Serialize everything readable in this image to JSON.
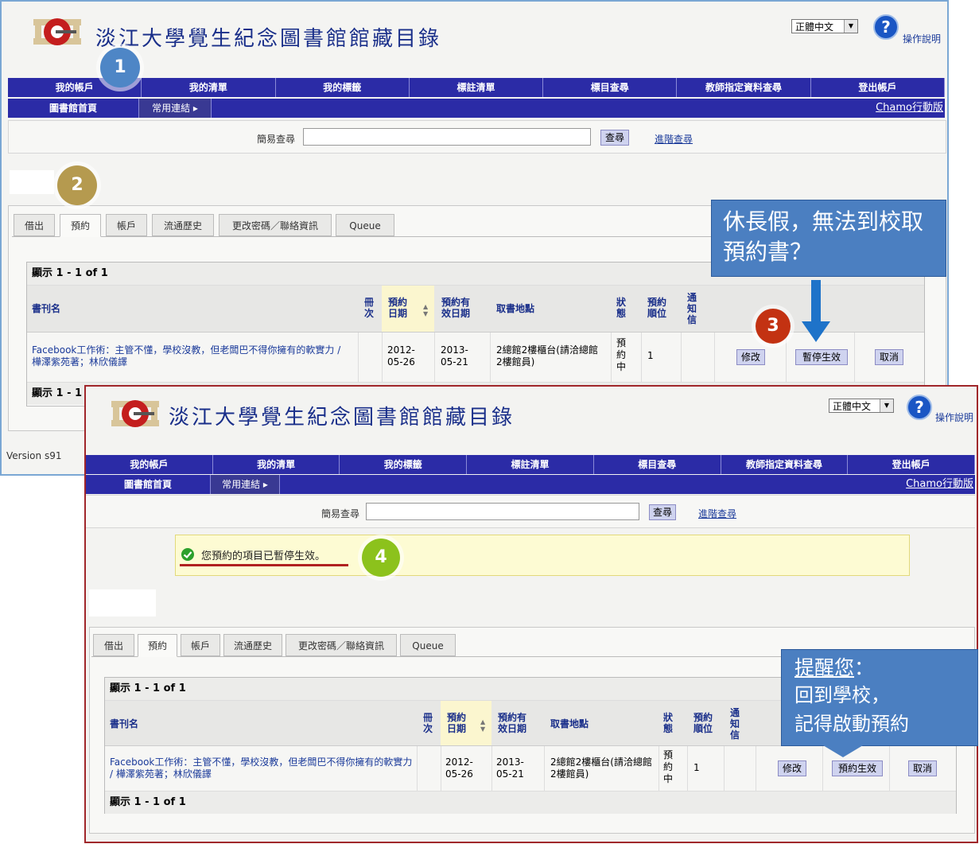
{
  "site": {
    "title": "淡江大學覺生紀念圖書館館藏目錄",
    "language_select": "正體中文",
    "help_label": "操作說明"
  },
  "nav": {
    "top": [
      "我的帳戶",
      "我的清單",
      "我的標籤",
      "標註清單",
      "標目查尋",
      "教師指定資料查尋",
      "登出帳戶"
    ],
    "library_home": "圖書館首頁",
    "common_links": "常用連結",
    "mobile": "Chamo行動版"
  },
  "search": {
    "label": "簡易查尋",
    "button": "查尋",
    "advanced": "進階查尋"
  },
  "tabs": [
    "借出",
    "預約",
    "帳戶",
    "流通歷史",
    "更改密碼／聯絡資訊",
    "Queue"
  ],
  "table": {
    "summary": "顯示 1 - 1 of 1",
    "headers": {
      "title": "書刊名",
      "volume": "冊次",
      "reserve_date": "預約日期",
      "expiry_date": "預約有效日期",
      "pickup": "取書地點",
      "status": "狀態",
      "queue": "預約順位",
      "notice": "通知信"
    },
    "row": {
      "title": "Facebook工作術：主管不懂，學校沒教，但老闆巴不得你擁有的軟實力 / 樺澤紫苑著；林欣儀譯",
      "reserve_date": "2012-05-26",
      "expiry_date": "2013-05-21",
      "pickup": "2總館2樓櫃台(請洽總館2樓館員)",
      "status": "預約中",
      "queue": "1"
    },
    "buttons": {
      "modify": "修改",
      "suspend": "暫停生效",
      "activate": "預約生效",
      "cancel": "取消"
    }
  },
  "version": "Version s91",
  "message": "您預約的項目已暫停生效。",
  "annotations": {
    "steps": [
      "1",
      "2",
      "3",
      "4"
    ],
    "callout_vacation": "休長假，無法到校取預約書？",
    "reminder_heading": "提醒您",
    "reminder_colon": "：",
    "reminder_line1": "回到學校，",
    "reminder_line2": "記得啟動預約"
  },
  "colors": {
    "nav": "#2b2ba6",
    "step1": "#4e86c6",
    "step2": "#b59a4f",
    "step3": "#c33212",
    "step4": "#8cc21c",
    "callout": "#4b7fc1",
    "success": "#2ca02c"
  }
}
